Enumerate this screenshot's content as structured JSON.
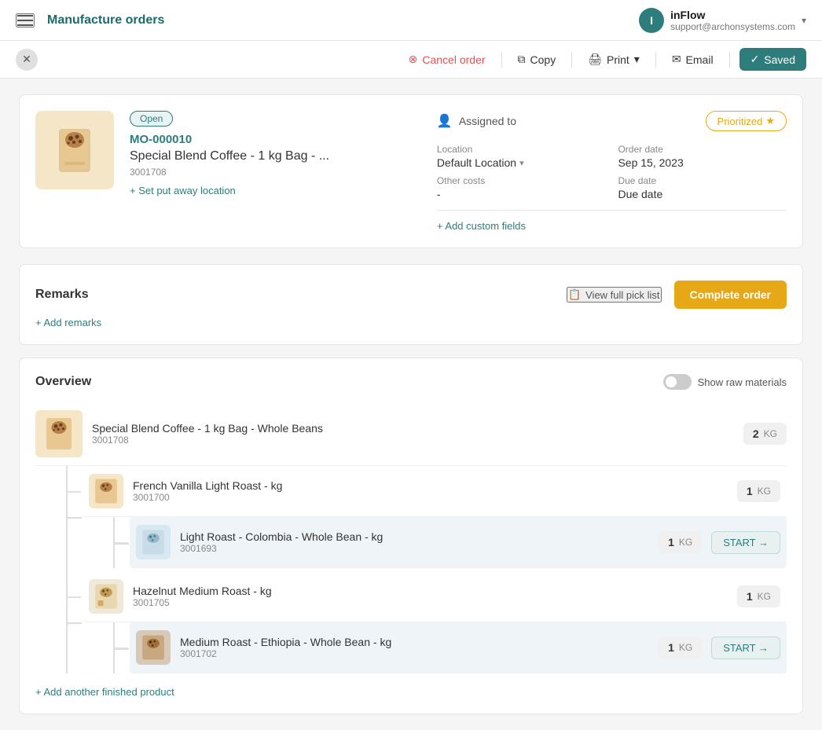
{
  "app": {
    "title": "Manufacture orders"
  },
  "user": {
    "name": "inFlow",
    "email": "support@archonsystems.com",
    "avatar_letter": "I"
  },
  "action_bar": {
    "cancel_label": "Cancel order",
    "copy_label": "Copy",
    "print_label": "Print",
    "email_label": "Email",
    "saved_label": "Saved"
  },
  "order": {
    "status": "Open",
    "number": "MO-000010",
    "product_name": "Special Blend Coffee - 1 kg Bag - ...",
    "sku": "3001708",
    "set_location": "+ Set put away location",
    "assigned_to_label": "Assigned to",
    "prioritized_label": "Prioritized",
    "location_label": "Location",
    "location_value": "Default Location",
    "order_date_label": "Order date",
    "order_date_value": "Sep 15, 2023",
    "other_costs_label": "Other costs",
    "other_costs_value": "-",
    "due_date_label": "Due date",
    "due_date_value": "Due date",
    "add_custom_label": "+ Add custom fields"
  },
  "remarks": {
    "title": "Remarks",
    "add_label": "+ Add remarks",
    "view_pick_list_label": "View full pick list",
    "complete_order_label": "Complete order"
  },
  "overview": {
    "title": "Overview",
    "toggle_label": "Show raw materials",
    "add_product_label": "+ Add another finished product",
    "root_item": {
      "name": "Special Blend Coffee - 1 kg Bag - Whole Beans",
      "sku": "3001708",
      "qty": "2",
      "unit": "KG"
    },
    "children": [
      {
        "name": "French Vanilla Light Roast - kg",
        "sku": "3001700",
        "qty": "1",
        "unit": "KG",
        "start": null,
        "sub_children": [
          {
            "name": "Light Roast - Colombia - Whole Bean - kg",
            "sku": "3001693",
            "qty": "1",
            "unit": "KG",
            "start": "START →",
            "highlighted": true
          }
        ]
      },
      {
        "name": "Hazelnut Medium Roast - kg",
        "sku": "3001705",
        "qty": "1",
        "unit": "KG",
        "start": null,
        "sub_children": [
          {
            "name": "Medium Roast - Ethiopia - Whole Bean - kg",
            "sku": "3001702",
            "qty": "1",
            "unit": "KG",
            "start": "START →",
            "highlighted": true
          }
        ]
      }
    ]
  }
}
